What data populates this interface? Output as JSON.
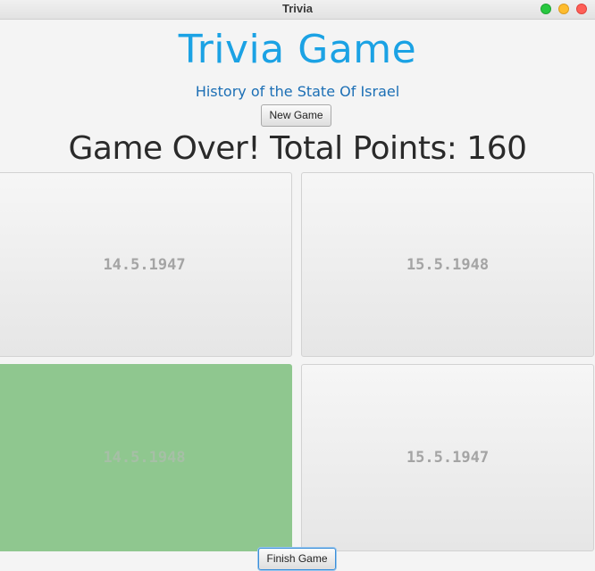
{
  "window": {
    "title": "Trivia"
  },
  "header": {
    "title": "Trivia Game",
    "subtitle": "History of the State Of Israel"
  },
  "controls": {
    "new_game_label": "New Game",
    "finish_game_label": "Finish Game"
  },
  "status": {
    "text": "Game Over! Total Points: 160"
  },
  "answers": [
    {
      "label": "14.5.1947",
      "correct": false
    },
    {
      "label": "15.5.1948",
      "correct": false
    },
    {
      "label": "14.5.1948",
      "correct": true
    },
    {
      "label": "15.5.1947",
      "correct": false
    }
  ],
  "colors": {
    "title": "#1ba2e4",
    "subtitle": "#1c6fb5",
    "correct_answer_bg": "#8fc78f",
    "answer_text": "#a4a4a4"
  }
}
